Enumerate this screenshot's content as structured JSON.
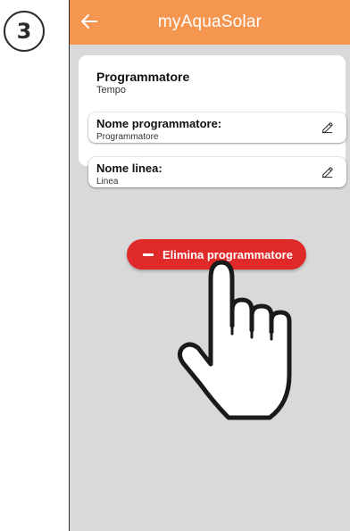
{
  "step": {
    "number": "3"
  },
  "app_bar": {
    "title": "myAquaSolar",
    "back_icon": "arrow-left-icon",
    "color": "#f49550"
  },
  "card": {
    "title": "Programmatore",
    "subtitle": "Tempo",
    "fields": [
      {
        "label": "Nome programmatore:",
        "value": "Programmatore",
        "icon": "pencil-icon"
      },
      {
        "label": "Nome linea:",
        "value": "Linea",
        "icon": "pencil-icon"
      }
    ]
  },
  "delete_button": {
    "label": "Elimina programmatore",
    "icon": "minus-icon",
    "color": "#e02a2a"
  },
  "overlay": {
    "icon": "pointing-hand-icon"
  }
}
